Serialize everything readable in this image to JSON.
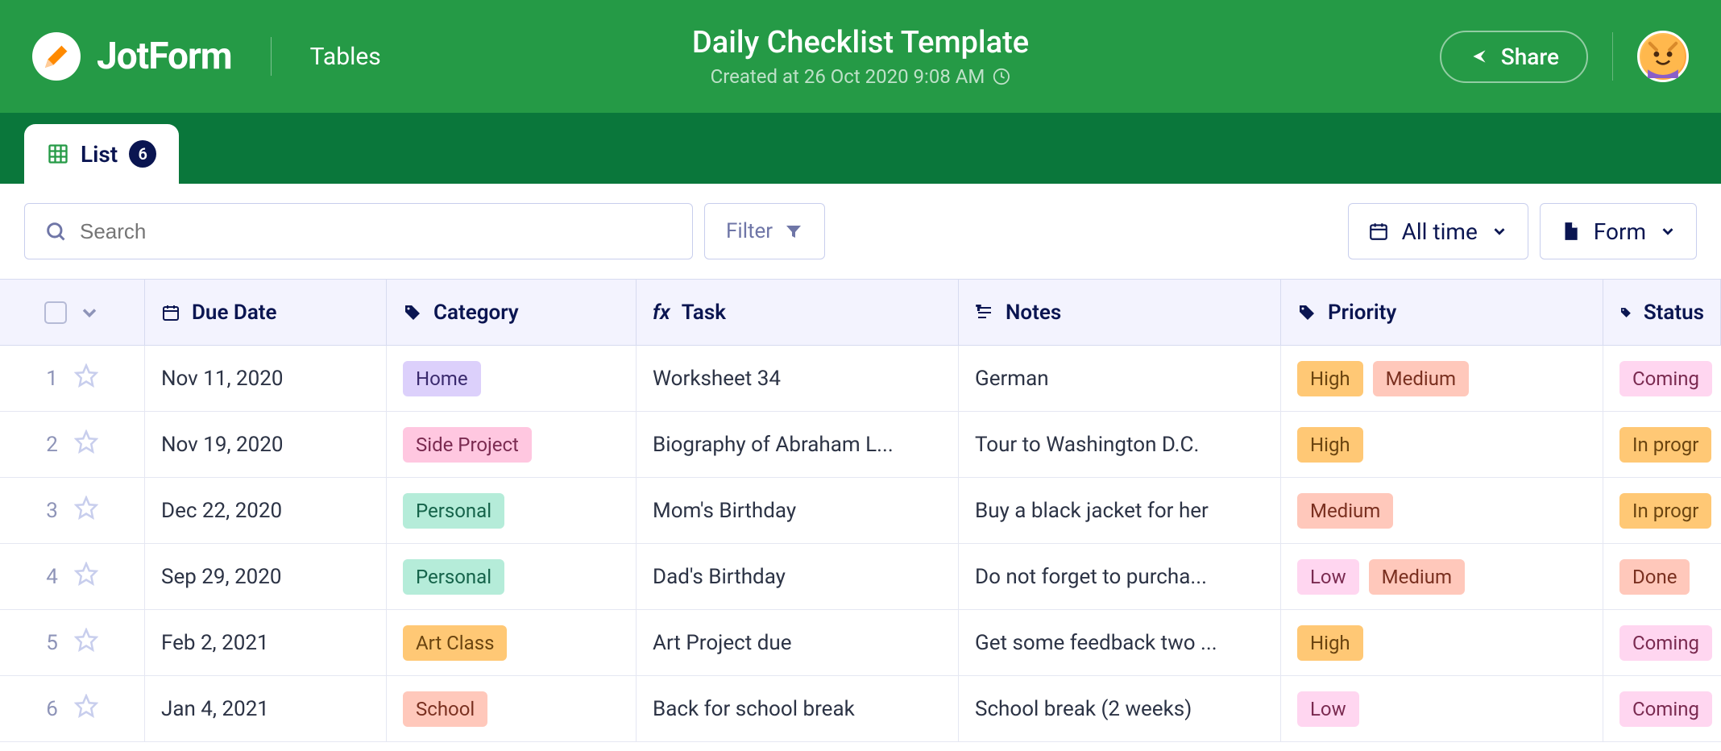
{
  "brand": {
    "name": "JotForm",
    "sublabel": "Tables"
  },
  "page": {
    "title": "Daily Checklist Template",
    "subtitle": "Created at 26 Oct 2020 9:08 AM"
  },
  "share_label": "Share",
  "tab": {
    "label": "List",
    "count": "6"
  },
  "search": {
    "placeholder": "Search"
  },
  "filter_label": "Filter",
  "time_filter": "All time",
  "form_label": "Form",
  "columns": {
    "due_date": "Due Date",
    "category": "Category",
    "task": "Task",
    "notes": "Notes",
    "priority": "Priority",
    "status": "Status"
  },
  "rows": [
    {
      "idx": "1",
      "due": "Nov 11, 2020",
      "category": "Home",
      "cat_class": "chip-home",
      "task": "Worksheet 34",
      "notes": "German",
      "priority": [
        {
          "t": "High",
          "c": "chip-high"
        },
        {
          "t": "Medium",
          "c": "chip-medium"
        }
      ],
      "status": {
        "t": "Coming",
        "c": "chip-coming"
      }
    },
    {
      "idx": "2",
      "due": "Nov 19, 2020",
      "category": "Side Project",
      "cat_class": "chip-side",
      "task": "Biography of Abraham L...",
      "notes": "Tour to Washington D.C.",
      "priority": [
        {
          "t": "High",
          "c": "chip-high"
        }
      ],
      "status": {
        "t": "In progr",
        "c": "chip-progress"
      }
    },
    {
      "idx": "3",
      "due": "Dec 22, 2020",
      "category": "Personal",
      "cat_class": "chip-personal",
      "task": "Mom's Birthday",
      "notes": "Buy a black jacket for her",
      "priority": [
        {
          "t": "Medium",
          "c": "chip-medium"
        }
      ],
      "status": {
        "t": "In progr",
        "c": "chip-progress"
      }
    },
    {
      "idx": "4",
      "due": "Sep 29, 2020",
      "category": "Personal",
      "cat_class": "chip-personal",
      "task": "Dad's Birthday",
      "notes": "Do not forget to purcha...",
      "priority": [
        {
          "t": "Low",
          "c": "chip-low"
        },
        {
          "t": "Medium",
          "c": "chip-medium"
        }
      ],
      "status": {
        "t": "Done",
        "c": "chip-done"
      }
    },
    {
      "idx": "5",
      "due": "Feb 2, 2021",
      "category": "Art Class",
      "cat_class": "chip-art",
      "task": "Art Project due",
      "notes": "Get some feedback two ...",
      "priority": [
        {
          "t": "High",
          "c": "chip-high"
        }
      ],
      "status": {
        "t": "Coming",
        "c": "chip-coming"
      }
    },
    {
      "idx": "6",
      "due": "Jan 4, 2021",
      "category": "School",
      "cat_class": "chip-school",
      "task": "Back for school break",
      "notes": "School break (2 weeks)",
      "priority": [
        {
          "t": "Low",
          "c": "chip-low"
        }
      ],
      "status": {
        "t": "Coming",
        "c": "chip-coming"
      }
    }
  ]
}
